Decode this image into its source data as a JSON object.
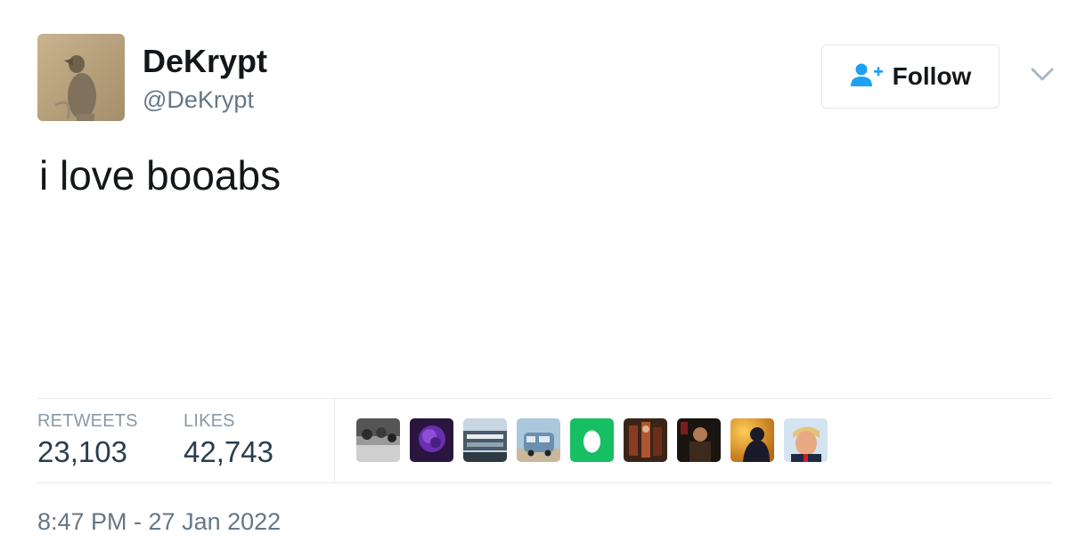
{
  "author": {
    "display_name": "DeKrypt",
    "handle": "@DeKrypt"
  },
  "follow_button": {
    "label": "Follow",
    "icon": "add-user-icon"
  },
  "tweet": {
    "text": "i love booabs",
    "timestamp": "8:47 PM - 27 Jan 2022"
  },
  "stats": {
    "retweets_label": "RETWEETS",
    "retweets_count": "23,103",
    "likes_label": "LIKES",
    "likes_count": "42,743"
  },
  "colors": {
    "accent": "#1da1f2",
    "text": "#14171a",
    "secondary": "#657786",
    "stat_value": "#2a3d4f",
    "egg_green": "#17bf63"
  }
}
